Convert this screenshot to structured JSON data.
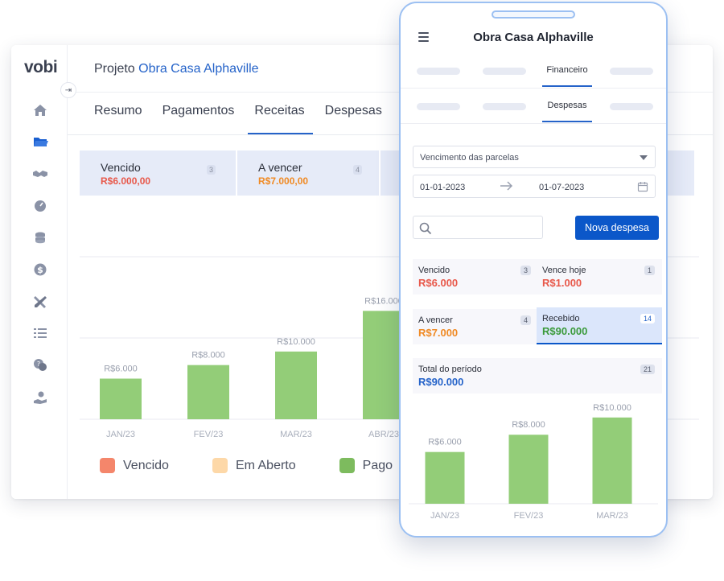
{
  "desktop": {
    "logo": "vobi",
    "project_prefix": "Projeto",
    "project_name": "Obra Casa Alphaville",
    "tabs": [
      "Resumo",
      "Pagamentos",
      "Receitas",
      "Despesas"
    ],
    "active_tab": 2,
    "summary": [
      {
        "label": "Vencido",
        "value": "R$6.000,00",
        "count": "3"
      },
      {
        "label": "A vencer",
        "value": "R$7.000,00",
        "count": "4"
      }
    ],
    "legend": [
      "Vencido",
      "Em Aberto",
      "Pago"
    ],
    "sidebar_icons": [
      "home-icon",
      "folder-icon",
      "handshake-icon",
      "gauge-icon",
      "coins-icon",
      "dollar-icon",
      "tools-icon",
      "list-icon",
      "chat-icon",
      "hand-money-icon"
    ],
    "colors": {
      "vencido": "#f4866b",
      "em_aberto": "#fdd8a8",
      "pago": "#7dbb5e",
      "accent": "#2563c9"
    }
  },
  "phone": {
    "title": "Obra Casa Alphaville",
    "tab_row1_active": "Financeiro",
    "tab_row2_active": "Despesas",
    "filter_select": "Vencimento das parcelas",
    "date_start": "01-01-2023",
    "date_end": "01-07-2023",
    "new_button": "Nova despesa",
    "stats": {
      "vencido": {
        "label": "Vencido",
        "value": "R$6.000",
        "count": "3"
      },
      "vence_hoje": {
        "label": "Vence hoje",
        "value": "R$1.000",
        "count": "1"
      },
      "a_vencer": {
        "label": "A vencer",
        "value": "R$7.000",
        "count": "4"
      },
      "recebido": {
        "label": "Recebido",
        "value": "R$90.000",
        "count": "14"
      },
      "total": {
        "label": "Total do período",
        "value": "R$90.000",
        "count": "21"
      }
    }
  },
  "chart_data": [
    {
      "type": "bar",
      "categories": [
        "JAN/23",
        "FEV/23",
        "MAR/23",
        "ABR/23"
      ],
      "values": [
        6000,
        8000,
        10000,
        16000
      ],
      "data_labels": [
        "R$6.000",
        "R$8.000",
        "R$10.000",
        "R$16.000"
      ],
      "ylim": [
        0,
        24000
      ],
      "grid": true,
      "color": "#93cd78"
    },
    {
      "type": "bar",
      "categories": [
        "JAN/23",
        "FEV/23",
        "MAR/23"
      ],
      "values": [
        6000,
        8000,
        10000
      ],
      "data_labels": [
        "R$6.000",
        "R$8.000",
        "R$10.000"
      ],
      "ylim": [
        0,
        12500
      ],
      "grid": false,
      "color": "#93cd78"
    }
  ]
}
